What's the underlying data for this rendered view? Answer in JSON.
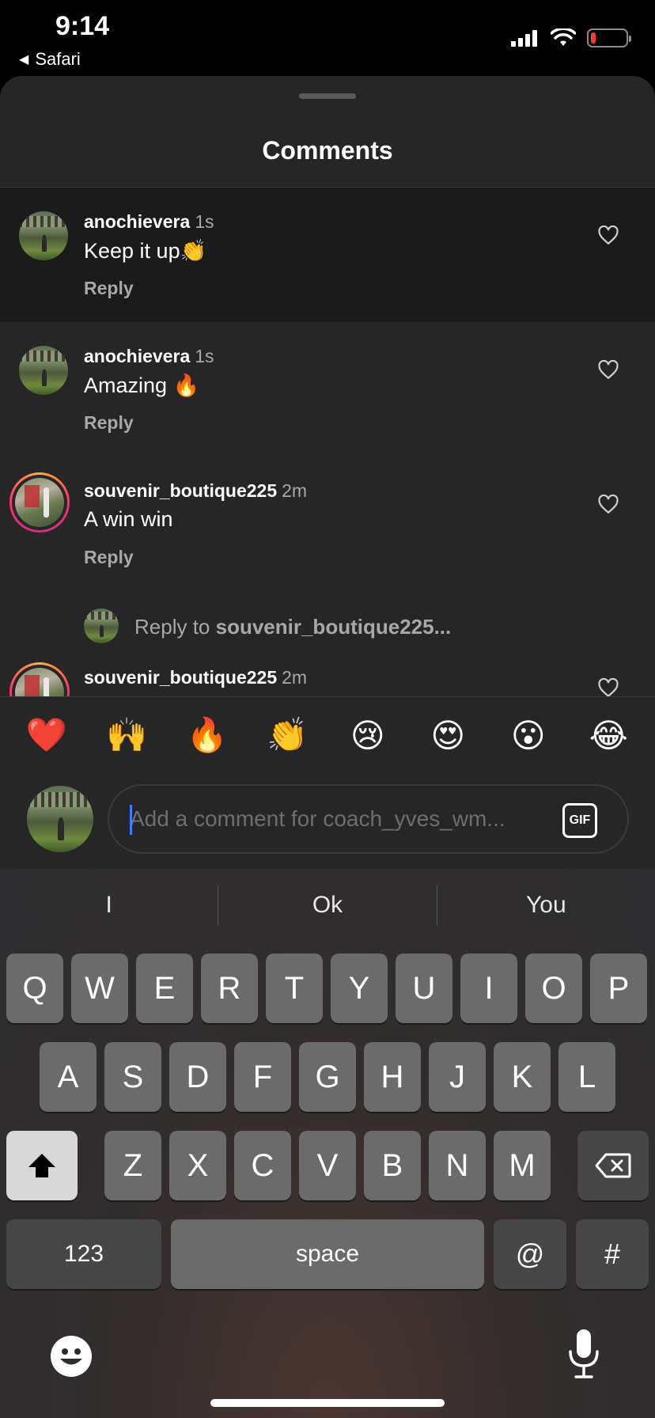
{
  "status": {
    "time": "9:14",
    "back_label": "Safari"
  },
  "sheet": {
    "title": "Comments"
  },
  "comments": [
    {
      "user": "anochievera",
      "time": "1s",
      "text": "Keep it up👏",
      "reply": "Reply"
    },
    {
      "user": "anochievera",
      "time": "1s",
      "text": "Amazing 🔥",
      "reply": "Reply"
    },
    {
      "user": "souvenir_boutique225",
      "time": "2m",
      "text": "A win win",
      "reply": "Reply"
    },
    {
      "user": "souvenir_boutique225",
      "time": "2m"
    }
  ],
  "reply_box": {
    "prefix": "Reply to ",
    "user": "souvenir_boutique225..."
  },
  "emoji_bar": [
    "❤️",
    "🙌",
    "🔥",
    "👏",
    "😢",
    "😍",
    "😮",
    "😂"
  ],
  "input": {
    "placeholder": "Add a comment for coach_yves_wm...",
    "gif_label": "GIF"
  },
  "keyboard": {
    "suggestions": [
      "I",
      "Ok",
      "You"
    ],
    "row1": [
      "Q",
      "W",
      "E",
      "R",
      "T",
      "Y",
      "U",
      "I",
      "O",
      "P"
    ],
    "row2": [
      "A",
      "S",
      "D",
      "F",
      "G",
      "H",
      "J",
      "K",
      "L"
    ],
    "row3": [
      "Z",
      "X",
      "C",
      "V",
      "B",
      "N",
      "M"
    ],
    "numbers_label": "123",
    "space_label": "space",
    "at_label": "@",
    "hash_label": "#"
  },
  "colors": {
    "sheet_bg": "#262626",
    "highlight_bg": "#1b1b1b",
    "secondary_text": "#a8a8a8",
    "caret": "#3d7bff",
    "battery": "#ff3b30"
  },
  "battery_level": 0.15,
  "icons": [
    "signal-icon",
    "wifi-icon",
    "battery-icon",
    "heart-icon",
    "gif-icon",
    "shift-icon",
    "backspace-icon",
    "emoji-keyboard-icon",
    "microphone-icon"
  ]
}
